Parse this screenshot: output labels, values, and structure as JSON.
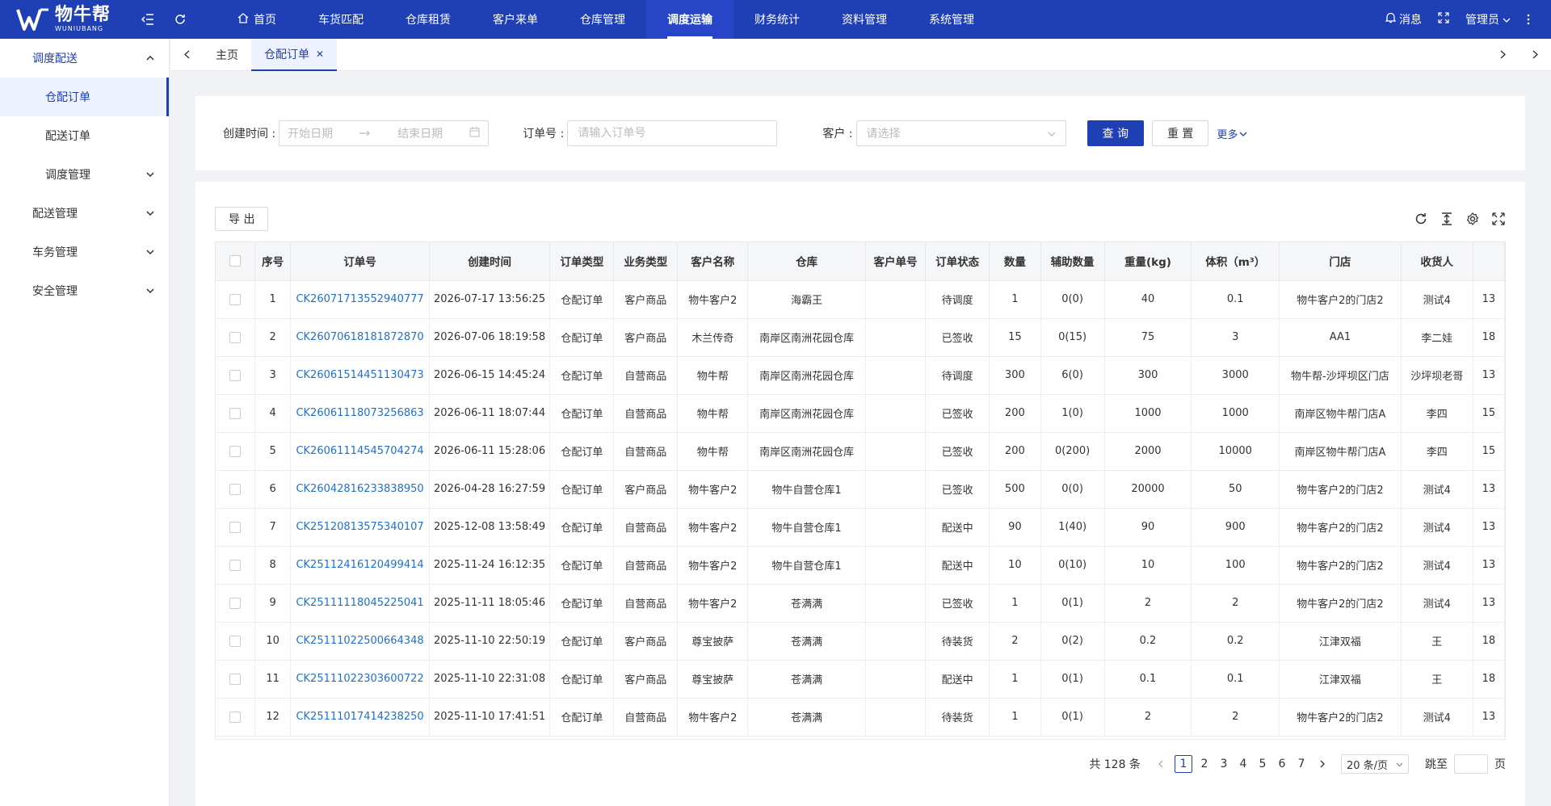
{
  "brand": {
    "name_cn": "物牛帮",
    "name_en": "WUNIUBANG"
  },
  "topnav": [
    {
      "label": "首页",
      "icon": "home-icon"
    },
    {
      "label": "车货匹配"
    },
    {
      "label": "仓库租赁"
    },
    {
      "label": "客户来单"
    },
    {
      "label": "仓库管理"
    },
    {
      "label": "调度运输",
      "active": true
    },
    {
      "label": "财务统计"
    },
    {
      "label": "资料管理"
    },
    {
      "label": "系统管理"
    }
  ],
  "topright": {
    "messages": "消息",
    "user": "管理员"
  },
  "sidebar": {
    "group1": "调度配送",
    "sub1": "仓配订单",
    "sub2": "配送订单",
    "sub3": "调度管理",
    "item2": "配送管理",
    "item3": "车务管理",
    "item4": "安全管理"
  },
  "tabs": {
    "home": "主页",
    "current": "仓配订单"
  },
  "filter": {
    "created_label": "创建时间 :",
    "start_placeholder": "开始日期",
    "end_placeholder": "结束日期",
    "order_label": "订单号 :",
    "order_placeholder": "请输入订单号",
    "customer_label": "客户 :",
    "customer_placeholder": "请选择",
    "query": "查 询",
    "reset": "重 置",
    "more": "更多"
  },
  "toolbar": {
    "export": "导 出"
  },
  "table": {
    "headers": [
      "序号",
      "订单号",
      "创建时间",
      "订单类型",
      "业务类型",
      "客户名称",
      "仓库",
      "客户单号",
      "订单状态",
      "数量",
      "辅助数量",
      "重量(kg)",
      "体积（m³）",
      "门店",
      "收货人",
      ""
    ],
    "rows": [
      [
        "1",
        "CK26071713552940777",
        "2026-07-17 13:56:25",
        "仓配订单",
        "客户商品",
        "物牛客户2",
        "海霸王",
        "",
        "待调度",
        "1",
        "0(0)",
        "40",
        "0.1",
        "物牛客户2的门店2",
        "测试4",
        "13"
      ],
      [
        "2",
        "CK26070618181872870",
        "2026-07-06 18:19:58",
        "仓配订单",
        "客户商品",
        "木兰传奇",
        "南岸区南洲花园仓库",
        "",
        "已签收",
        "15",
        "0(15)",
        "75",
        "3",
        "AA1",
        "李二娃",
        "18"
      ],
      [
        "3",
        "CK26061514451130473",
        "2026-06-15 14:45:24",
        "仓配订单",
        "自营商品",
        "物牛帮",
        "南岸区南洲花园仓库",
        "",
        "待调度",
        "300",
        "6(0)",
        "300",
        "3000",
        "物牛帮-沙坪坝区门店",
        "沙坪坝老哥",
        "13"
      ],
      [
        "4",
        "CK26061118073256863",
        "2026-06-11 18:07:44",
        "仓配订单",
        "自营商品",
        "物牛帮",
        "南岸区南洲花园仓库",
        "",
        "已签收",
        "200",
        "1(0)",
        "1000",
        "1000",
        "南岸区物牛帮门店A",
        "李四",
        "15"
      ],
      [
        "5",
        "CK26061114545704274",
        "2026-06-11 15:28:06",
        "仓配订单",
        "自营商品",
        "物牛帮",
        "南岸区南洲花园仓库",
        "",
        "已签收",
        "200",
        "0(200)",
        "2000",
        "10000",
        "南岸区物牛帮门店A",
        "李四",
        "15"
      ],
      [
        "6",
        "CK26042816233838950",
        "2026-04-28 16:27:59",
        "仓配订单",
        "客户商品",
        "物牛客户2",
        "物牛自营仓库1",
        "",
        "已签收",
        "500",
        "0(0)",
        "20000",
        "50",
        "物牛客户2的门店2",
        "测试4",
        "13"
      ],
      [
        "7",
        "CK25120813575340107",
        "2025-12-08 13:58:49",
        "仓配订单",
        "自营商品",
        "物牛客户2",
        "物牛自营仓库1",
        "",
        "配送中",
        "90",
        "1(40)",
        "90",
        "900",
        "物牛客户2的门店2",
        "测试4",
        "13"
      ],
      [
        "8",
        "CK25112416120499414",
        "2025-11-24 16:12:35",
        "仓配订单",
        "自营商品",
        "物牛客户2",
        "物牛自营仓库1",
        "",
        "配送中",
        "10",
        "0(10)",
        "10",
        "100",
        "物牛客户2的门店2",
        "测试4",
        "13"
      ],
      [
        "9",
        "CK25111118045225041",
        "2025-11-11 18:05:46",
        "仓配订单",
        "自营商品",
        "物牛客户2",
        "苍满满",
        "",
        "已签收",
        "1",
        "0(1)",
        "2",
        "2",
        "物牛客户2的门店2",
        "测试4",
        "13"
      ],
      [
        "10",
        "CK25111022500664348",
        "2025-11-10 22:50:19",
        "仓配订单",
        "客户商品",
        "尊宝披萨",
        "苍满满",
        "",
        "待装货",
        "2",
        "0(2)",
        "0.2",
        "0.2",
        "江津双福",
        "王",
        "18"
      ],
      [
        "11",
        "CK25111022303600722",
        "2025-11-10 22:31:08",
        "仓配订单",
        "客户商品",
        "尊宝披萨",
        "苍满满",
        "",
        "配送中",
        "1",
        "0(1)",
        "0.1",
        "0.1",
        "江津双福",
        "王",
        "18"
      ],
      [
        "12",
        "CK25111017414238250",
        "2025-11-10 17:41:51",
        "仓配订单",
        "自营商品",
        "物牛客户2",
        "苍满满",
        "",
        "待装货",
        "1",
        "0(1)",
        "2",
        "2",
        "物牛客户2的门店2",
        "测试4",
        "13"
      ]
    ]
  },
  "pagination": {
    "total": "共 128 条",
    "pages": [
      "1",
      "2",
      "3",
      "4",
      "5",
      "6",
      "7"
    ],
    "current": "1",
    "size": "20 条/页",
    "jump_label": "跳至",
    "page_suffix": "页"
  },
  "colors": {
    "primary": "#1f3fb4",
    "link": "#1f6fd1"
  }
}
